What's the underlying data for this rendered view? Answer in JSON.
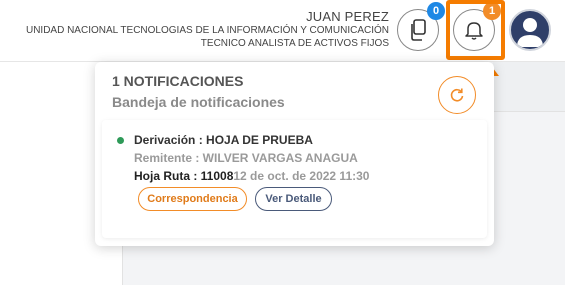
{
  "user": {
    "name": "JUAN PEREZ",
    "unit": "UNIDAD NACIONAL TECNOLOGIAS DE LA INFORMACIÓN Y COMUNICACIÓN",
    "role": "TECNICO ANALISTA DE ACTIVOS FIJOS"
  },
  "header": {
    "docs_badge": "0",
    "bell_badge": "1"
  },
  "notifications": {
    "title": "1 NOTIFICACIONES",
    "subtitle": "Bandeja de notificaciones",
    "items": [
      {
        "derivacion": "Derivación : HOJA DE PRUEBA",
        "remitente": "Remitente : WILVER VARGAS ANAGUA",
        "hoja_label": "Hoja Ruta : 11008",
        "date": "12 de oct. de 2022 11:30",
        "btn_correspondencia": "Correspondencia",
        "btn_detalle": "Ver Detalle"
      }
    ]
  },
  "colors": {
    "accent": "#f28c28",
    "badge_blue": "#1e88e5",
    "status_dot": "#2e9a58"
  },
  "icons": [
    "documents-icon",
    "bell-icon",
    "user-avatar-icon",
    "refresh-icon",
    "arrow-up-icon"
  ]
}
